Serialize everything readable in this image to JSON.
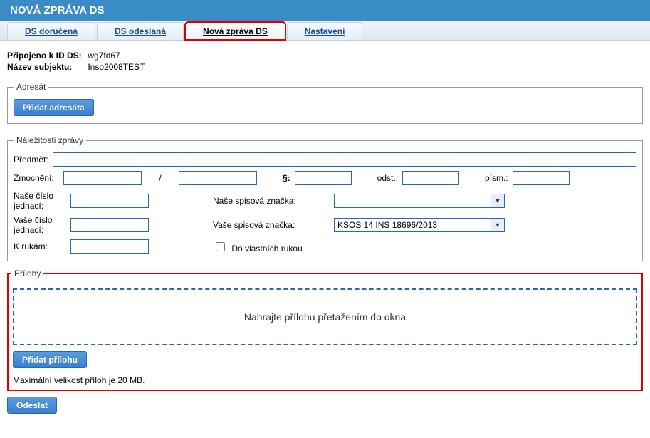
{
  "header": {
    "title": "NOVÁ ZPRÁVA DS"
  },
  "tabs": {
    "received": "DS doručená",
    "sent": "DS odeslaná",
    "new": "Nová zpráva DS",
    "settings": "Nastavení"
  },
  "conn": {
    "id_label": "Připojeno k ID DS:",
    "id_value": "wg7fd67",
    "subject_label": "Název subjektu:",
    "subject_value": "Inso2008TEST"
  },
  "recipient": {
    "legend": "Adresát",
    "add_btn": "Přidat adresáta"
  },
  "msg": {
    "legend": "Náležitosti zprávy",
    "subject_label": "Předmět:",
    "subject_value": "",
    "zmocneni_label": "Zmocnění:",
    "zmocneni_a": "",
    "sep_slash": "/",
    "zmocneni_b": "",
    "par_label": "§:",
    "par_value": "",
    "odst_label": "odst.:",
    "odst_value": "",
    "pism_label": "písm.:",
    "pism_value": "",
    "ourcj_label": "Naše číslo jednací:",
    "ourcj_value": "",
    "oursp_label": "Naše spisová značka:",
    "oursp_value": "",
    "yourcj_label": "Vaše číslo jednací:",
    "yourcj_value": "",
    "yoursp_label": "Vaše spisová značka:",
    "yoursp_value": "KSOS 14 INS 18696/2013",
    "kruk_label": "K rukám:",
    "kruk_value": "",
    "ownhands_label": "Do vlastních rukou"
  },
  "attach": {
    "legend": "Přílohy",
    "drop_text": "Nahrajte přílohu přetažením do okna",
    "add_btn": "Přidat přílohu",
    "limit_text": "Maximální velikost příloh je 20 MB."
  },
  "send_btn": "Odeslat"
}
